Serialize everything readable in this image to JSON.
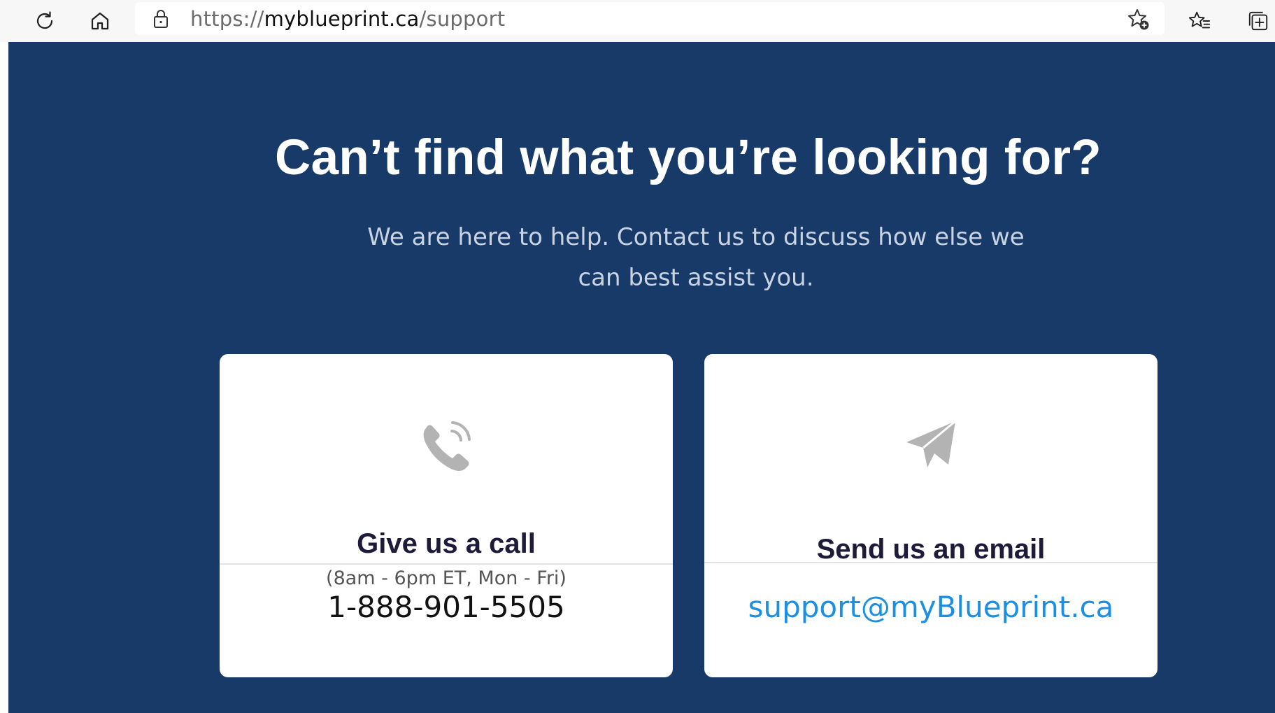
{
  "browser": {
    "url_scheme": "https://",
    "url_host": "myblueprint.ca",
    "url_path": "/support",
    "icons": [
      "refresh-icon",
      "home-icon",
      "lock-icon",
      "add-favorite-icon",
      "favorites-icon",
      "collections-icon"
    ]
  },
  "hero": {
    "headline": "Can’t find what you’re looking for?",
    "subtext": "We are here to help. Contact us to discuss how else we can best assist you."
  },
  "cards": {
    "call": {
      "icon": "phone-icon",
      "title": "Give us a call",
      "hours": "(8am - 6pm ET, Mon - Fri)",
      "phone": "1-888-901-5505"
    },
    "email": {
      "icon": "paper-plane-icon",
      "title": "Send us an email",
      "address": "support@myBlueprint.ca"
    }
  },
  "colors": {
    "page_background": "#173a68",
    "card_background": "#ffffff",
    "card_title": "#1d1a3a",
    "email_link": "#1b8fe3",
    "icon_gray": "#b3b3b3"
  }
}
